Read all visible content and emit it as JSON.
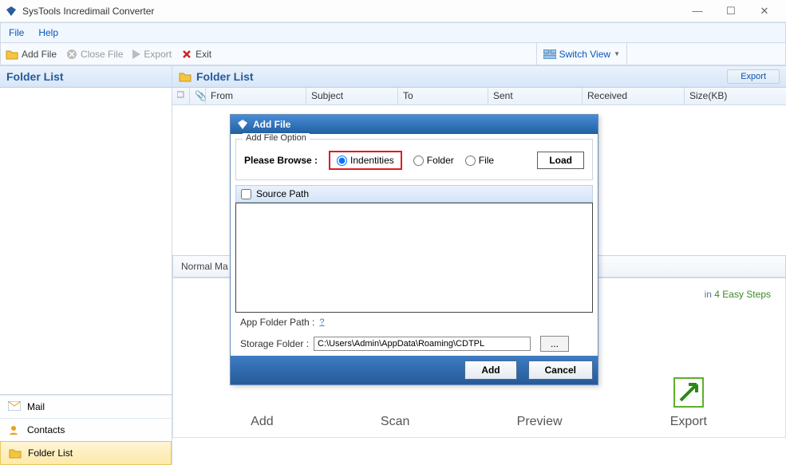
{
  "window": {
    "title": "SysTools Incredimail Converter"
  },
  "menu": {
    "file": "File",
    "help": "Help"
  },
  "toolbar": {
    "add_file": "Add File",
    "close_file": "Close File",
    "export": "Export",
    "exit": "Exit",
    "switch_view": "Switch View"
  },
  "sidebar": {
    "header": "Folder List",
    "nav": {
      "mail": "Mail",
      "contacts": "Contacts",
      "folder_list": "Folder List"
    }
  },
  "content": {
    "header": "Folder List",
    "export_btn": "Export",
    "columns": {
      "from": "From",
      "subject": "Subject",
      "to": "To",
      "sent": "Sent",
      "received": "Received",
      "size": "Size(KB)"
    },
    "normal": "Normal Ma",
    "steps_title_a": "in ",
    "steps_title_b": "4 Easy Steps",
    "steps": {
      "add": "Add",
      "scan": "Scan",
      "preview": "Preview",
      "export": "Export"
    }
  },
  "dialog": {
    "title": "Add File",
    "legend": "Add File Option",
    "browse_label": "Please Browse :",
    "opt_identities": "Indentities",
    "opt_folder": "Folder",
    "opt_file": "File",
    "load": "Load",
    "source_path": "Source Path",
    "app_folder_label": "App Folder Path :",
    "qmark": "?",
    "storage_label": "Storage Folder :",
    "storage_value": "C:\\Users\\Admin\\AppData\\Roaming\\CDTPL",
    "browse_btn": "...",
    "add": "Add",
    "cancel": "Cancel"
  }
}
